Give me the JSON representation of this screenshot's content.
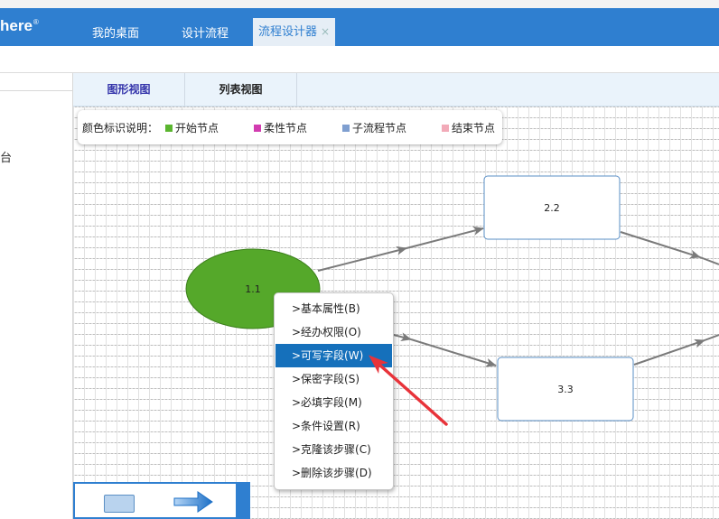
{
  "app": {
    "logo": "here",
    "logo_mark": "®"
  },
  "tabs": [
    {
      "label": "我的桌面"
    },
    {
      "label": "设计流程"
    },
    {
      "label": "流程设计器",
      "close": "×"
    }
  ],
  "left_panel": {
    "partial_text": "台"
  },
  "view_tabs": [
    {
      "label": "图形视图"
    },
    {
      "label": "列表视图"
    }
  ],
  "legend": {
    "title": "颜色标识说明：",
    "items": [
      {
        "label": "开始节点",
        "color": "#5ab52f"
      },
      {
        "label": "柔性节点",
        "color": "#d23cb0"
      },
      {
        "label": "子流程节点",
        "color": "#7f9fd0"
      },
      {
        "label": "结束节点",
        "color": "#f2aab8"
      }
    ]
  },
  "nodes": {
    "start": "1.1",
    "n22": "2.2",
    "n33": "3.3"
  },
  "context_menu": {
    "items": [
      {
        "label": ">基本属性(B)"
      },
      {
        "label": ">经办权限(O)"
      },
      {
        "label": ">可写字段(W)",
        "highlighted": true
      },
      {
        "label": ">保密字段(S)"
      },
      {
        "label": ">必填字段(M)"
      },
      {
        "label": ">条件设置(R)"
      },
      {
        "label": ">克隆该步骤(C)"
      },
      {
        "label": ">删除该步骤(D)"
      }
    ]
  },
  "colors": {
    "header": "#2f7fd0",
    "start_node": "#55a82a",
    "menu_highlight": "#1570bb",
    "annotation_arrow": "#e8333a"
  }
}
